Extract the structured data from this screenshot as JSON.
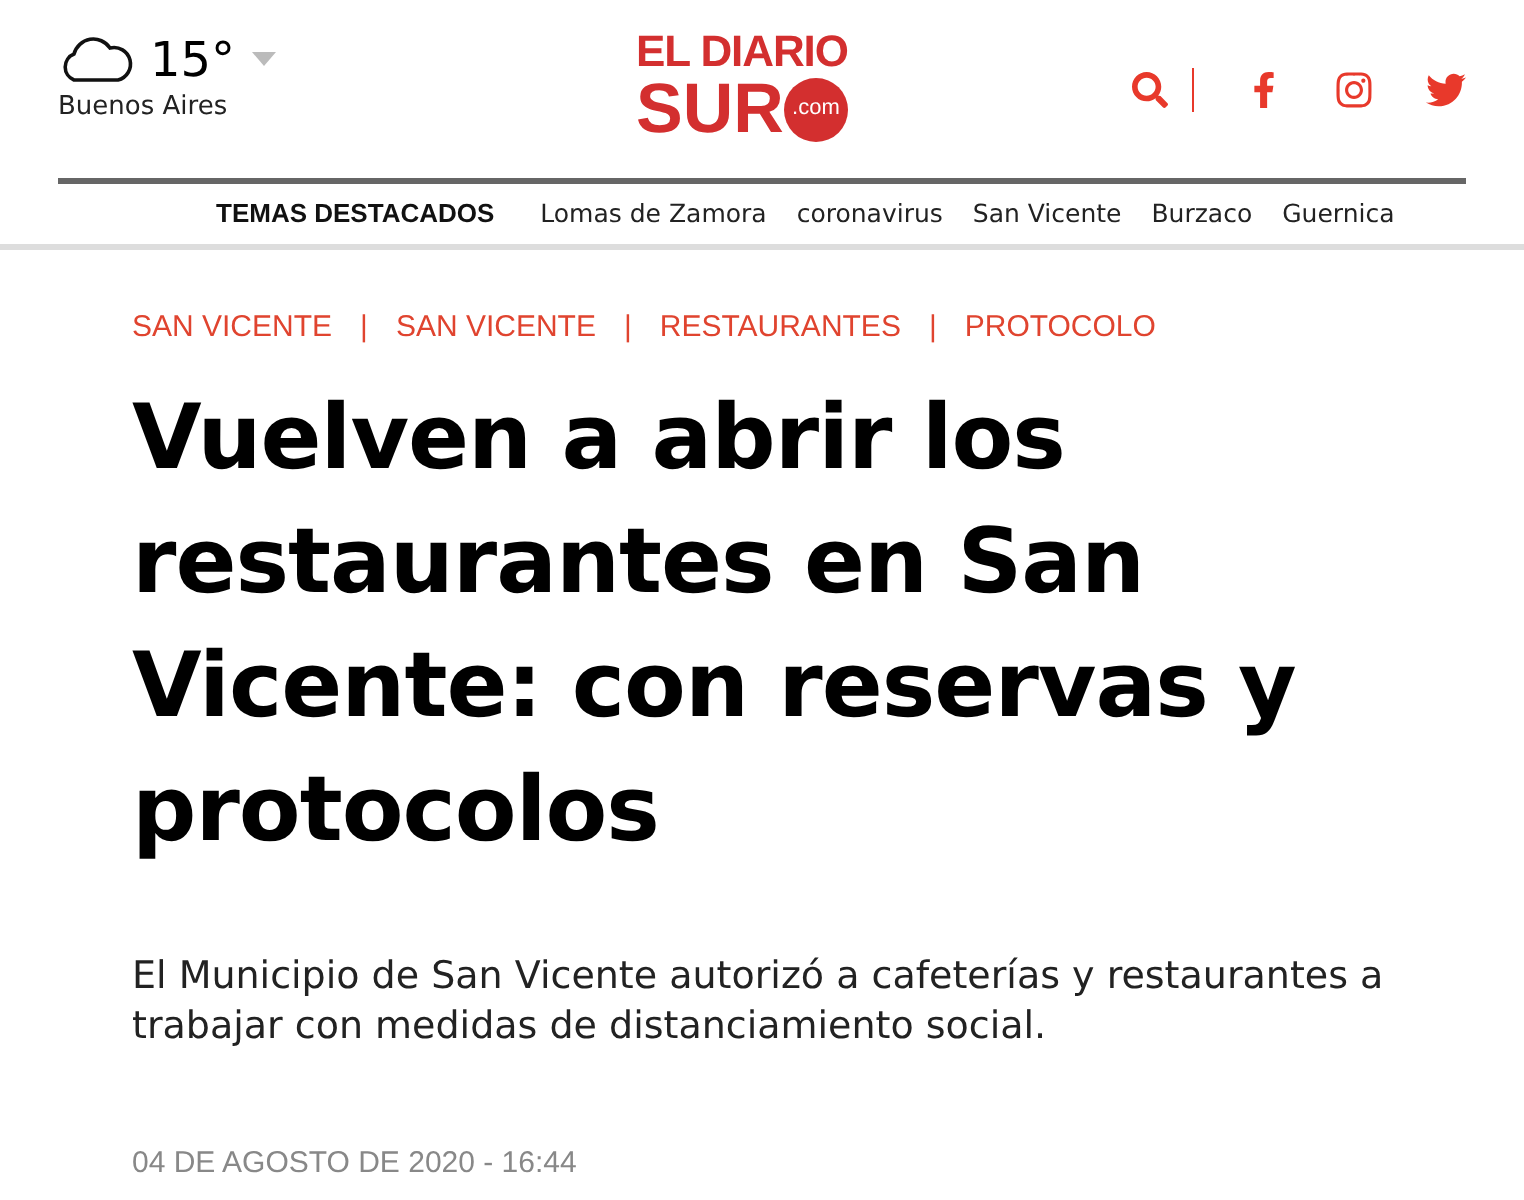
{
  "weather": {
    "temperature": "15°",
    "city": "Buenos Aires"
  },
  "logo": {
    "line_1": "EL DIARIO",
    "line_2": "SUR",
    "badge": ".com"
  },
  "trending": {
    "title": "TEMAS DESTACADOS",
    "items": [
      "Lomas de Zamora",
      "coronavirus",
      "San Vicente",
      "Burzaco",
      "Guernica"
    ]
  },
  "article": {
    "tags": [
      "SAN VICENTE",
      "SAN VICENTE",
      "RESTAURANTES",
      "PROTOCOLO"
    ],
    "tag_separator": "|",
    "headline": "Vuelven a abrir los restaurantes en San Vicente: con reservas y protocolos",
    "summary": "El Municipio de San Vicente autorizó a cafeterías y restaurantes a trabajar con medidas de distanciamiento social.",
    "date": "04 DE AGOSTO DE 2020 - 16:44"
  }
}
